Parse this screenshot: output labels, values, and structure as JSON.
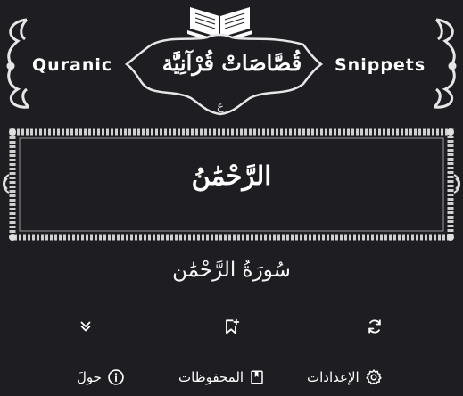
{
  "header": {
    "brand_left": "Quranic",
    "brand_right": "Snippets",
    "title_arabic": "قُصَّاصَاتْ قُرْآنِيَّة",
    "small_mark": "ع"
  },
  "verse": {
    "text": "الرَّحْمَٰنُ",
    "surah": "سُورَةُ الرَّحْمَٰن"
  },
  "actions": {
    "expand_icon": "chevrons-down-icon",
    "bookmark_icon": "bookmark-add-icon",
    "refresh_icon": "refresh-icon"
  },
  "nav": {
    "about_label": "حولَ",
    "saved_label": "المحفوظات",
    "settings_label": "الإعدادات"
  },
  "colors": {
    "background": "#1e1d21",
    "foreground": "#ffffff",
    "ornament": "#d8d8d8"
  }
}
